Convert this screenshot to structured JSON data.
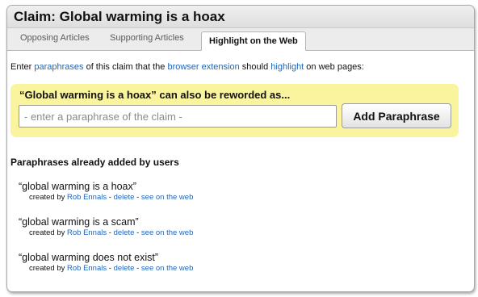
{
  "claim": {
    "title": "Claim: Global warming is a hoax"
  },
  "tabs": [
    {
      "label": "Opposing Articles",
      "active": false
    },
    {
      "label": "Supporting Articles",
      "active": false
    },
    {
      "label": "Highlight on the Web",
      "active": true
    }
  ],
  "instructions": {
    "t1": "Enter ",
    "link1": "paraphrases",
    "t2": " of this claim that the ",
    "link2": "browser extension",
    "t3": " should ",
    "link3": "highlight",
    "t4": " on web pages:"
  },
  "add_box": {
    "title": "“Global warming is a hoax” can also be reworded as...",
    "input_value": "",
    "input_placeholder": "- enter a paraphrase of the claim -",
    "button_label": "Add Paraphrase"
  },
  "paraphrases": {
    "section_title": "Paraphrases already added by users",
    "items": [
      {
        "text": "“global warming is a hoax”",
        "created_by_label": "created by ",
        "author": "Rob Ennals",
        "sep1": " - ",
        "delete": "delete",
        "sep2": " - ",
        "see": "see on the web"
      },
      {
        "text": "“global warming is a scam”",
        "created_by_label": "created by ",
        "author": "Rob Ennals",
        "sep1": " - ",
        "delete": "delete",
        "sep2": " - ",
        "see": "see on the web"
      },
      {
        "text": "“global warming does not exist”",
        "created_by_label": "created by ",
        "author": "Rob Ennals",
        "sep1": " - ",
        "delete": "delete",
        "sep2": " - ",
        "see": "see on the web"
      }
    ]
  },
  "colors": {
    "link": "#2166b8",
    "highlight_box": "#fbf49e",
    "title_bar": "#e6e6e6"
  }
}
